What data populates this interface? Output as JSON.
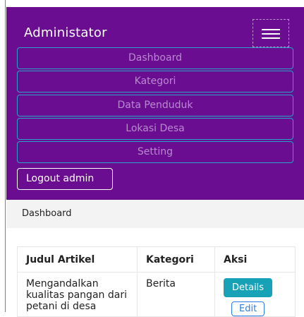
{
  "navbar": {
    "brand": "Administator",
    "toggler_icon": "hamburger-menu-icon",
    "items": [
      {
        "label": "Dashboard"
      },
      {
        "label": "Kategori"
      },
      {
        "label": "Data Penduduk"
      },
      {
        "label": "Lokasi Desa"
      },
      {
        "label": "Setting"
      }
    ],
    "logout_label": "Logout admin",
    "background_color": "#6a0d91",
    "item_border_color": "#27a4c8"
  },
  "breadcrumb": {
    "current": "Dashboard"
  },
  "table": {
    "headers": {
      "title": "Judul Artikel",
      "category": "Kategori",
      "action": "Aksi"
    },
    "rows": [
      {
        "title": "Mengandalkan kualitas pangan dari petani di desa",
        "category": "Berita",
        "details_label": "Details",
        "edit_label": "Edit"
      }
    ]
  }
}
